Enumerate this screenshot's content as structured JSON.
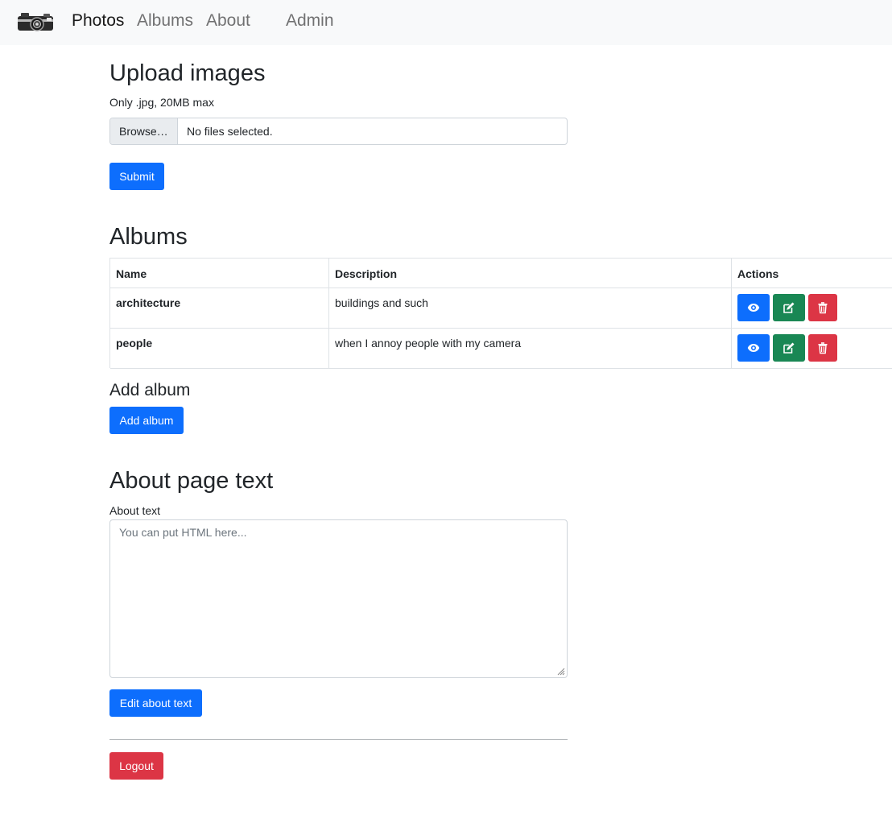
{
  "nav": {
    "brand": "Photos",
    "albums": "Albums",
    "about": "About",
    "admin": "Admin"
  },
  "upload": {
    "title": "Upload images",
    "hint": "Only .jpg, 20MB max",
    "browse_label": "Browse…",
    "file_status": "No files selected.",
    "submit_label": "Submit"
  },
  "albums": {
    "title": "Albums",
    "columns": [
      "Name",
      "Description",
      "Actions"
    ],
    "rows": [
      {
        "name": "architecture",
        "description": "buildings and such"
      },
      {
        "name": "people",
        "description": "when I annoy people with my camera"
      }
    ],
    "action_icons": [
      "eye-icon",
      "edit-icon",
      "trash-icon"
    ],
    "add_title": "Add album",
    "add_button": "Add album"
  },
  "about_section": {
    "title": "About page text",
    "label": "About text",
    "placeholder": "You can put HTML here...",
    "value": "",
    "submit_label": "Edit about text"
  },
  "logout_label": "Logout",
  "colors": {
    "primary": "#0d6efd",
    "success": "#198754",
    "danger": "#dc3545",
    "navbar_bg": "#f8f9fa"
  }
}
